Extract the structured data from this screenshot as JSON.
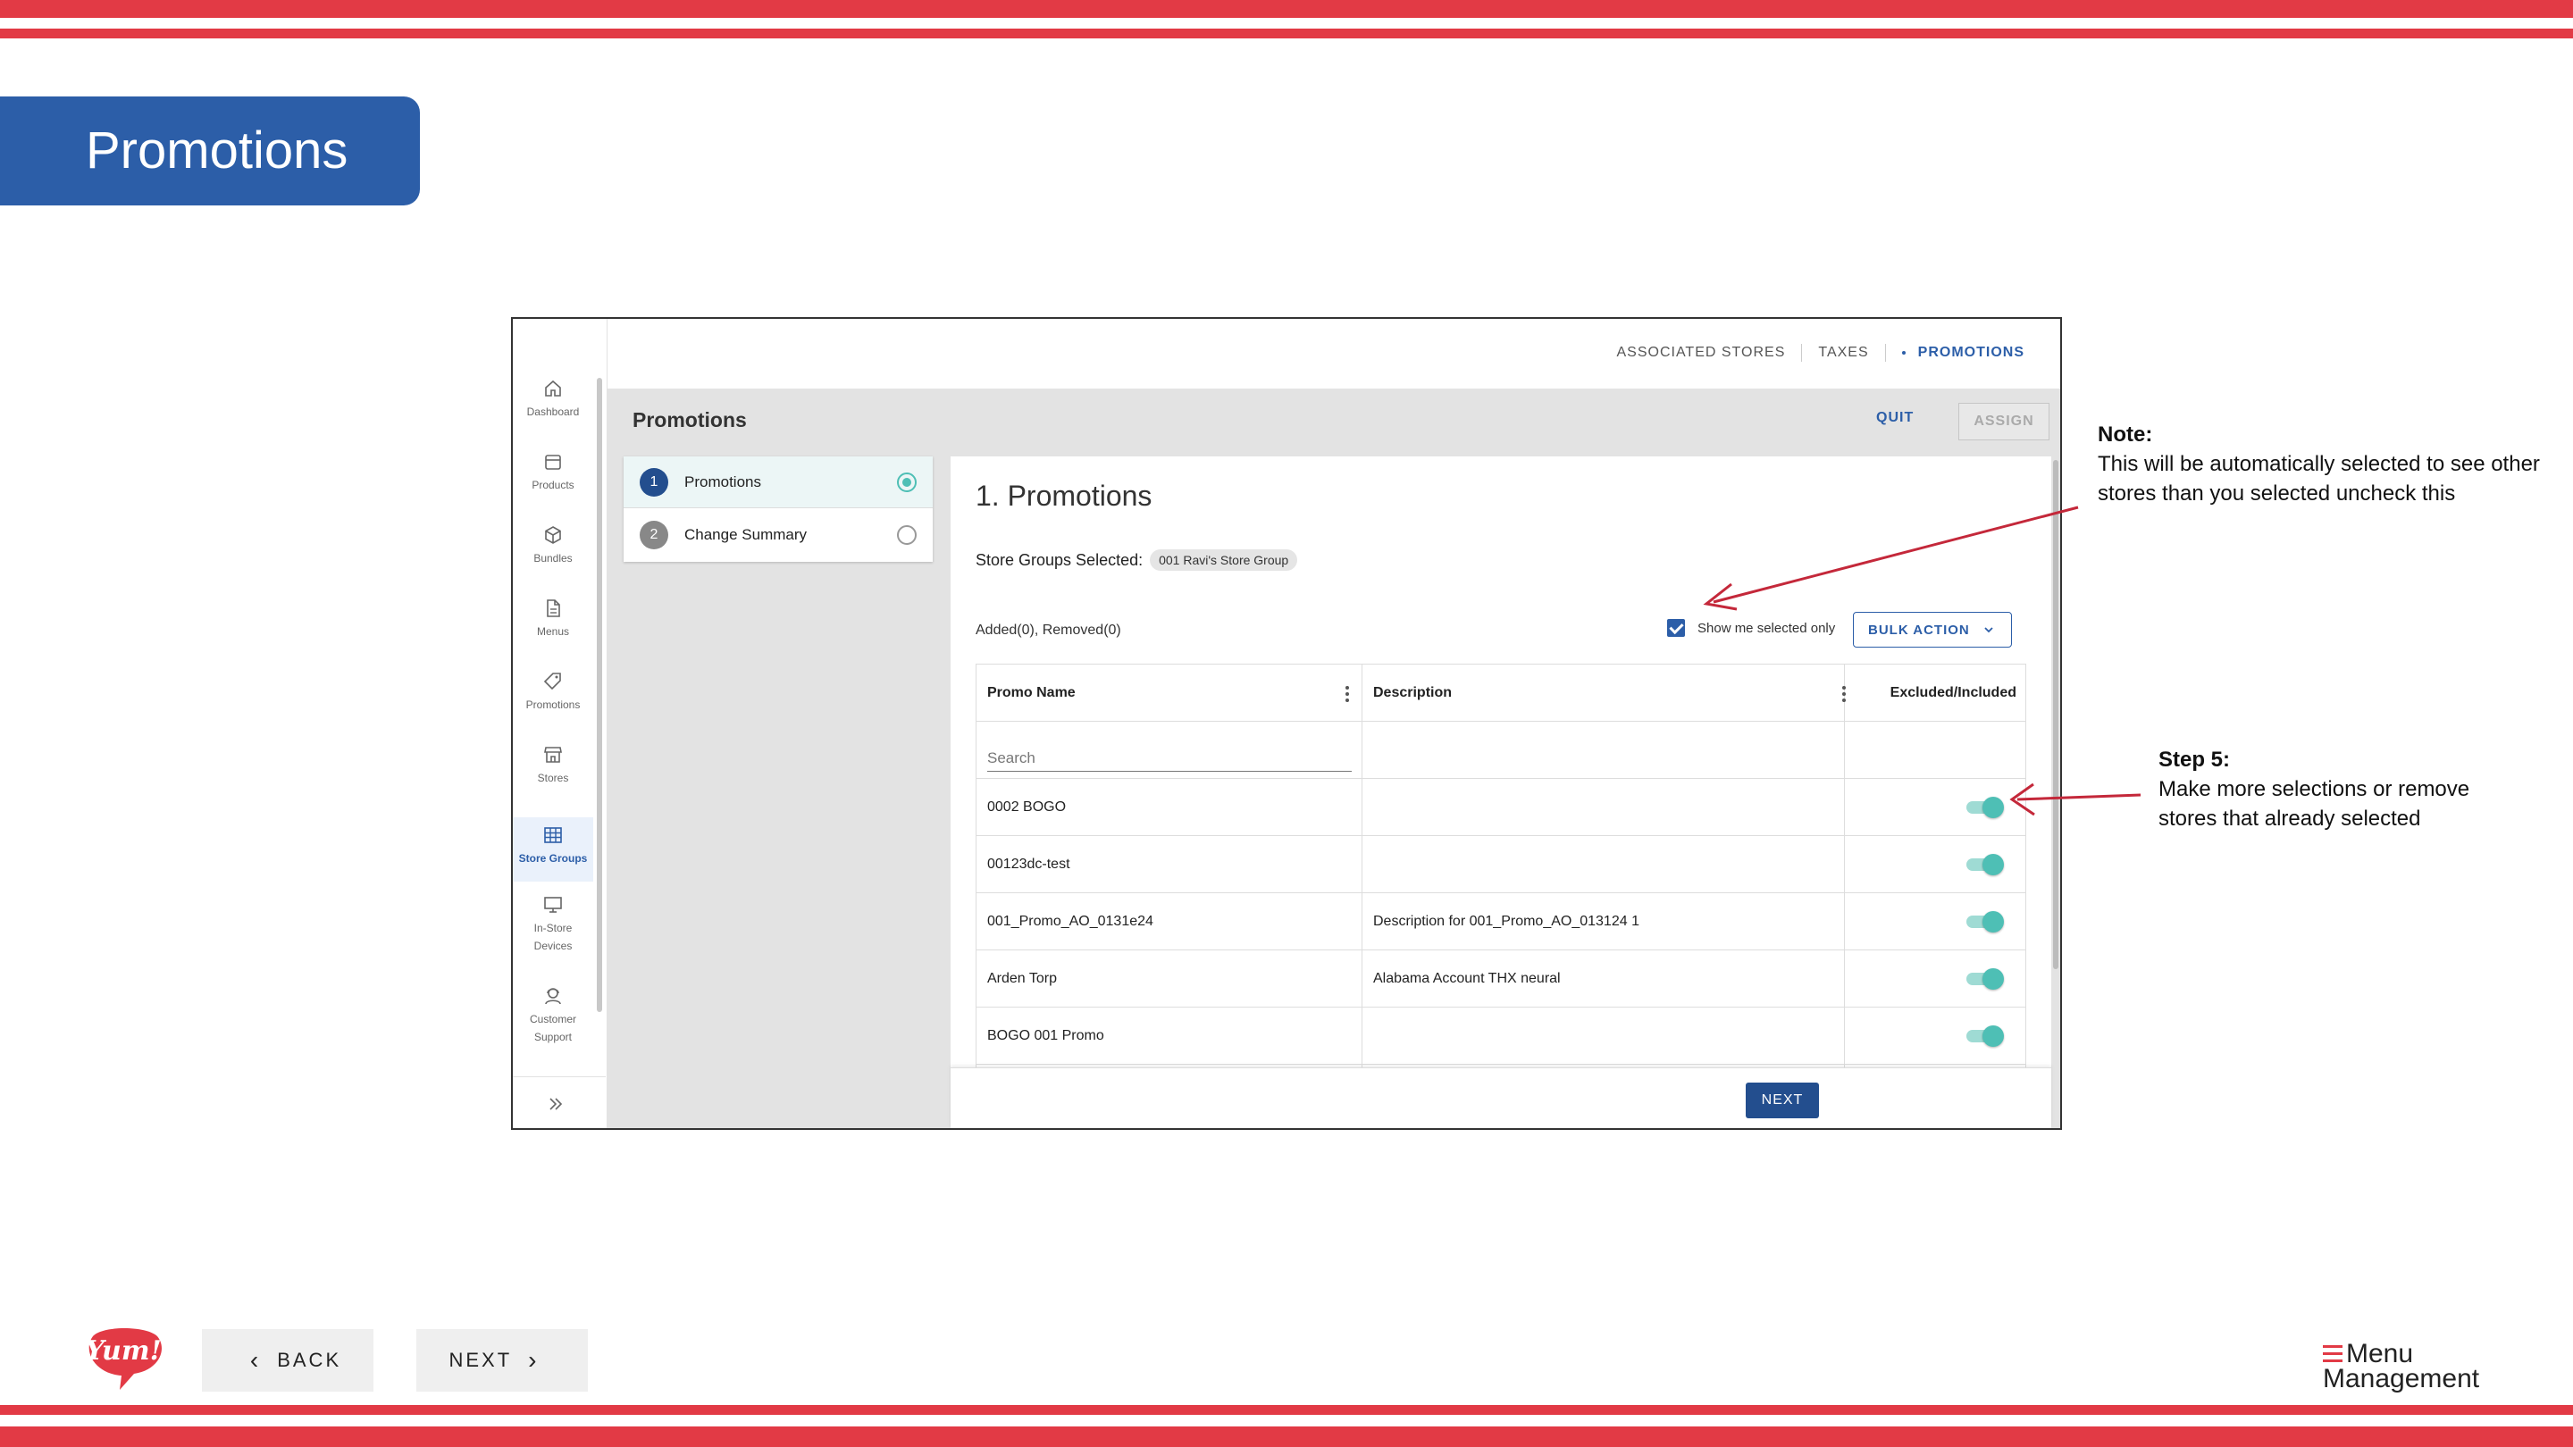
{
  "slide": {
    "title": "Promotions",
    "back_label": "BACK",
    "next_label": "NEXT",
    "brand_line1": "Menu",
    "brand_line2": "Management",
    "logo_text": "Yum!"
  },
  "topnav": {
    "links": [
      "ASSOCIATED STORES",
      "TAXES",
      "PROMOTIONS"
    ],
    "active": "PROMOTIONS"
  },
  "sidebar": {
    "items": [
      {
        "label": "Dashboard",
        "icon": "home-icon"
      },
      {
        "label": "Products",
        "icon": "box-icon"
      },
      {
        "label": "Bundles",
        "icon": "cube-icon"
      },
      {
        "label": "Menus",
        "icon": "document-icon"
      },
      {
        "label": "Promotions",
        "icon": "tag-icon"
      },
      {
        "label": "Stores",
        "icon": "store-icon"
      },
      {
        "label": "Store Groups",
        "icon": "grid-icon",
        "active": true
      },
      {
        "label": "In-Store Devices",
        "line1": "In-Store",
        "line2": "Devices",
        "icon": "monitor-icon"
      },
      {
        "label": "Customer Support",
        "line1": "Customer",
        "line2": "Support",
        "icon": "support-icon"
      }
    ],
    "expand_icon": "double-chevron-right-icon"
  },
  "header": {
    "title": "Promotions",
    "quit_label": "QUIT",
    "assign_label": "ASSIGN"
  },
  "stepper": {
    "steps": [
      {
        "number": "1",
        "label": "Promotions",
        "active": true
      },
      {
        "number": "2",
        "label": "Change Summary",
        "active": false
      }
    ]
  },
  "main": {
    "heading": "1. Promotions",
    "store_groups_label": "Store Groups Selected:",
    "store_group_chip": "001 Ravi's Store Group",
    "added_removed": "Added(0), Removed(0)",
    "show_selected_label": "Show me selected only",
    "show_selected_checked": true,
    "bulk_action_label": "BULK ACTION",
    "next_label": "NEXT"
  },
  "table": {
    "columns": [
      "Promo Name",
      "Description",
      "Excluded/Included"
    ],
    "search_placeholder": "Search",
    "rows": [
      {
        "name": "0002 BOGO",
        "description": "",
        "included": true
      },
      {
        "name": "00123dc-test",
        "description": "",
        "included": true
      },
      {
        "name": "001_Promo_AO_0131e24",
        "description": "Description for 001_Promo_AO_013124 1",
        "included": true
      },
      {
        "name": "Arden Torp",
        "description": "Alabama Account THX neural",
        "included": true
      },
      {
        "name": "BOGO 001 Promo",
        "description": "",
        "included": true
      }
    ]
  },
  "annotations": {
    "note_title": "Note:",
    "note_text": "This will be automatically selected to see other stores than you selected uncheck this",
    "step_title": "Step 5:",
    "step_text": "Make more selections or remove stores that already selected",
    "arrow_color": "#c4283a"
  },
  "colors": {
    "stripe": "#e23a45",
    "title_tab": "#2c5ea8",
    "primary": "#234e8e",
    "toggle": "#4ebfb5"
  }
}
